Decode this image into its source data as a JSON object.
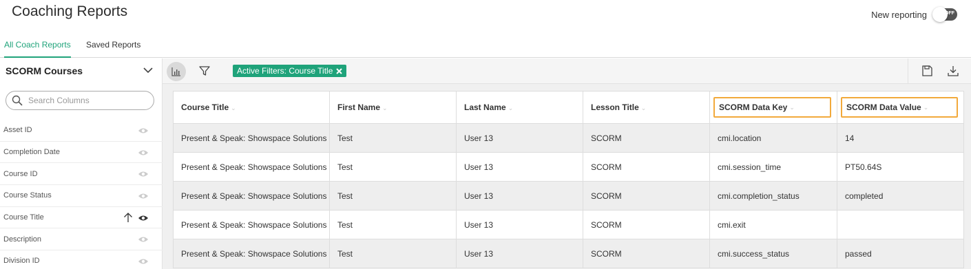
{
  "header": {
    "title": "Coaching Reports",
    "new_reporting_label": "New reporting",
    "toggle_state": "OFF"
  },
  "tabs": [
    {
      "label": "All Coach Reports",
      "active": true
    },
    {
      "label": "Saved Reports",
      "active": false
    }
  ],
  "toolbar": {
    "dataset": "SCORM Courses",
    "active_filter": "Active Filters: Course Title"
  },
  "sidebar": {
    "search_placeholder": "Search Columns",
    "columns": [
      {
        "label": "Asset ID"
      },
      {
        "label": "Completion Date"
      },
      {
        "label": "Course ID"
      },
      {
        "label": "Course Status"
      },
      {
        "label": "Course Title",
        "sorted": "ascending",
        "visible": true
      },
      {
        "label": "Description"
      },
      {
        "label": "Division ID"
      }
    ]
  },
  "table": {
    "headers": [
      "Course Title",
      "First Name",
      "Last Name",
      "Lesson Title",
      "SCORM Data Key",
      "SCORM Data Value"
    ],
    "rows": [
      [
        "Present & Speak: Showspace Solutions",
        "Test",
        "User 13",
        "SCORM",
        "cmi.location",
        "14"
      ],
      [
        "Present & Speak: Showspace Solutions",
        "Test",
        "User 13",
        "SCORM",
        "cmi.session_time",
        "PT50.64S"
      ],
      [
        "Present & Speak: Showspace Solutions",
        "Test",
        "User 13",
        "SCORM",
        "cmi.completion_status",
        "completed"
      ],
      [
        "Present & Speak: Showspace Solutions",
        "Test",
        "User 13",
        "SCORM",
        "cmi.exit",
        ""
      ],
      [
        "Present & Speak: Showspace Solutions",
        "Test",
        "User 13",
        "SCORM",
        "cmi.success_status",
        "passed"
      ]
    ]
  },
  "colors": {
    "accent": "#1fa37a",
    "highlight": "#f2a93b"
  }
}
